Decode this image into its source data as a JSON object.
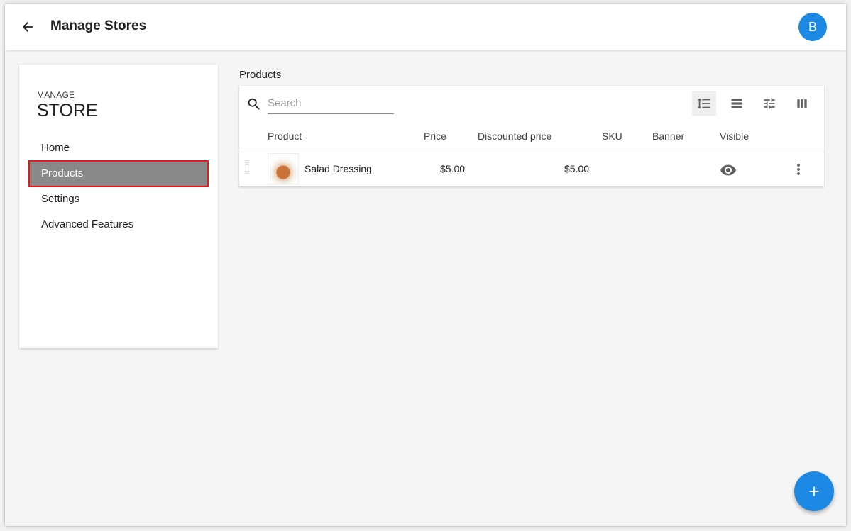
{
  "header": {
    "title": "Manage Stores",
    "avatar_initial": "B"
  },
  "sidebar": {
    "heading_small": "MANAGE",
    "heading_big": "STORE",
    "items": [
      {
        "label": "Home",
        "active": false
      },
      {
        "label": "Products",
        "active": true
      },
      {
        "label": "Settings",
        "active": false
      },
      {
        "label": "Advanced Features",
        "active": false
      }
    ]
  },
  "main": {
    "section_title": "Products",
    "search": {
      "placeholder": "Search",
      "value": ""
    },
    "toolbar": [
      "row-density-icon",
      "view-list-icon",
      "filter-tune-icon",
      "columns-icon"
    ],
    "columns": [
      "Product",
      "Price",
      "Discounted price",
      "SKU",
      "Banner",
      "Visible"
    ],
    "rows": [
      {
        "product": "Salad Dressing",
        "price": "$5.00",
        "discounted_price": "$5.00",
        "sku": "",
        "banner": "",
        "visible": true
      }
    ]
  },
  "colors": {
    "accent": "#1e88e5",
    "active_nav": "#888888",
    "highlight_border": "#e01b1b"
  }
}
